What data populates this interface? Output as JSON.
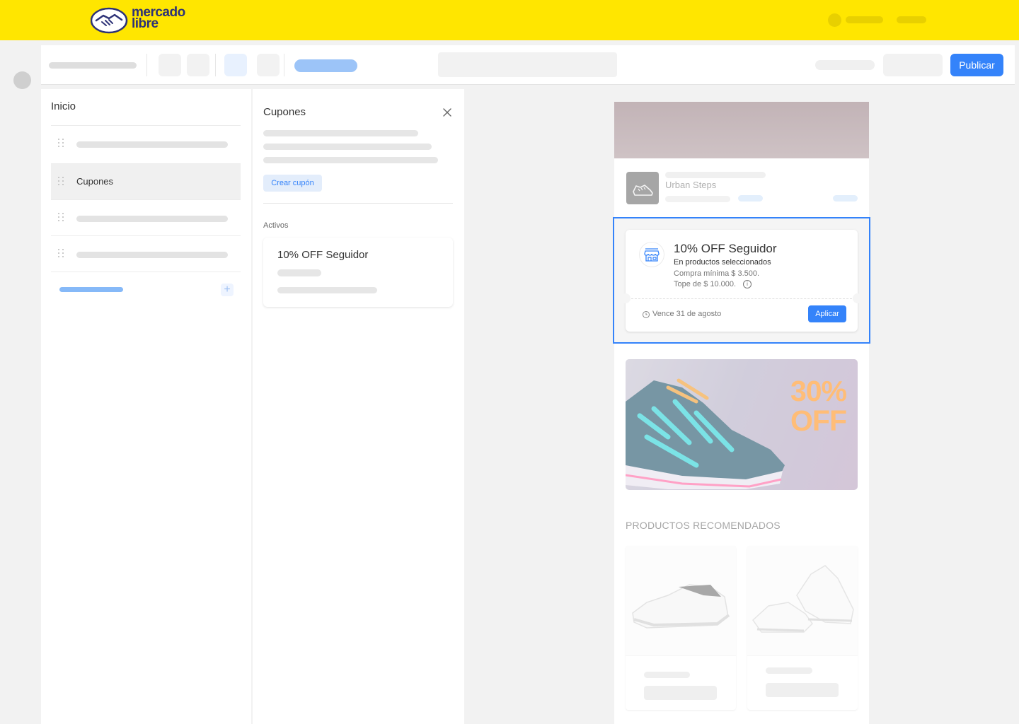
{
  "header": {
    "logo_line1": "mercado",
    "logo_line2": "libre",
    "brand_color": "#ffe600"
  },
  "toolbar": {
    "publish_label": "Publicar",
    "accent_color": "#3483fa"
  },
  "sidebar": {
    "title": "Inicio",
    "items": [
      {
        "label": ""
      },
      {
        "label": "Cupones",
        "selected": true
      },
      {
        "label": ""
      },
      {
        "label": ""
      }
    ],
    "add_icon": "plus-icon"
  },
  "coupons_panel": {
    "title": "Cupones",
    "close_icon": "close-icon",
    "create_label": "Crear cupón",
    "section_label": "Activos",
    "active_coupons": [
      {
        "title": "10% OFF Seguidor"
      }
    ]
  },
  "preview": {
    "store_name": "Urban Steps",
    "coupon": {
      "icon": "store-icon",
      "title": "10% OFF Seguidor",
      "subtitle": "En productos seleccionados",
      "min_purchase": "Compra mínima $ 3.500.",
      "cap": "Tope de $ 10.000.",
      "expiry": "Vence 31 de agosto",
      "apply_label": "Aplicar"
    },
    "promo_text": "30% OFF",
    "recommended_title": "PRODUCTOS RECOMENDADOS"
  }
}
